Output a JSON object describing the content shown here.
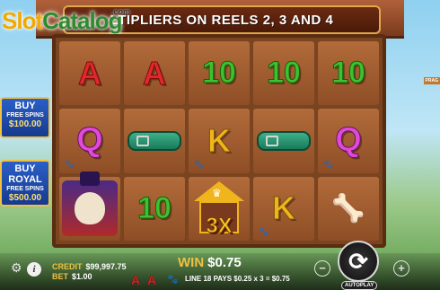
{
  "header": {
    "banner_text": "LTIPLIERS ON REELS 2, 3 AND 4",
    "logo_slot": "Slot",
    "logo_catalog": "Catalog",
    "logo_com": ".com"
  },
  "side": {
    "buy": {
      "line1": "BUY",
      "line2": "FREE SPINS",
      "price": "$100.00"
    },
    "buy_royal": {
      "line1": "BUY",
      "line2": "ROYAL",
      "line3": "FREE SPINS",
      "price": "$500.00"
    },
    "brand_tag": "PRAG"
  },
  "reels": {
    "rows": [
      [
        {
          "sym": "A"
        },
        {
          "sym": "A"
        },
        {
          "sym": "10"
        },
        {
          "sym": "10"
        },
        {
          "sym": "10"
        }
      ],
      [
        {
          "sym": "Q"
        },
        {
          "sym": "collar"
        },
        {
          "sym": "K"
        },
        {
          "sym": "collar"
        },
        {
          "sym": "Q"
        }
      ],
      [
        {
          "sym": "dog"
        },
        {
          "sym": "10"
        },
        {
          "sym": "house",
          "mult": "3X"
        },
        {
          "sym": "K"
        },
        {
          "sym": "bones"
        }
      ]
    ]
  },
  "bottom": {
    "credit_label": "CREDIT",
    "credit_value": "$99,997.75",
    "bet_label": "BET",
    "bet_value": "$1.00",
    "win_label": "WIN",
    "win_value": "$0.75",
    "line_text": "LINE 18 PAYS $0.25 x 3 = $0.75",
    "mini_a": "A",
    "autoplay": "AUTOPLAY"
  },
  "colors": {
    "accent_gold": "#f0c040",
    "buy_blue": "#2a5fc8",
    "wood": "#8e4e26"
  }
}
